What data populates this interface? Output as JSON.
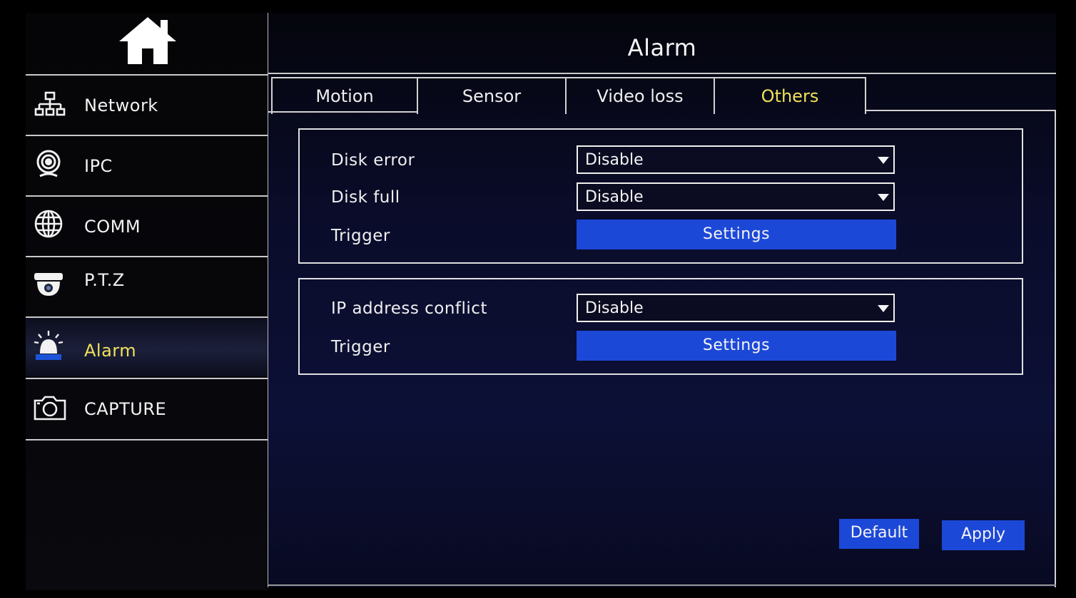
{
  "sidebar": {
    "items": [
      {
        "label": "Network",
        "icon": "network-icon"
      },
      {
        "label": "IPC",
        "icon": "ipc-camera-icon"
      },
      {
        "label": "COMM",
        "icon": "globe-icon"
      },
      {
        "label": "P.T.Z",
        "icon": "dome-camera-icon"
      },
      {
        "label": "Alarm",
        "icon": "alarm-siren-icon"
      },
      {
        "label": "CAPTURE",
        "icon": "camera-icon"
      }
    ],
    "active_index": 4
  },
  "header": {
    "title": "Alarm"
  },
  "tabs": [
    {
      "label": "Motion"
    },
    {
      "label": "Sensor"
    },
    {
      "label": "Video loss"
    },
    {
      "label": "Others"
    }
  ],
  "active_tab": "Others",
  "group1": {
    "disk_error": {
      "label": "Disk error",
      "value": "Disable"
    },
    "disk_full": {
      "label": "Disk full",
      "value": "Disable"
    },
    "trigger": {
      "label": "Trigger",
      "button": "Settings"
    }
  },
  "group2": {
    "ip_conflict": {
      "label": "IP address conflict",
      "value": "Disable"
    },
    "trigger": {
      "label": "Trigger",
      "button": "Settings"
    }
  },
  "footer": {
    "default_label": "Default",
    "apply_label": "Apply"
  },
  "colors": {
    "accent": "#1c48d8",
    "active_text": "#f1e15a",
    "background": "#0a0c2a"
  }
}
